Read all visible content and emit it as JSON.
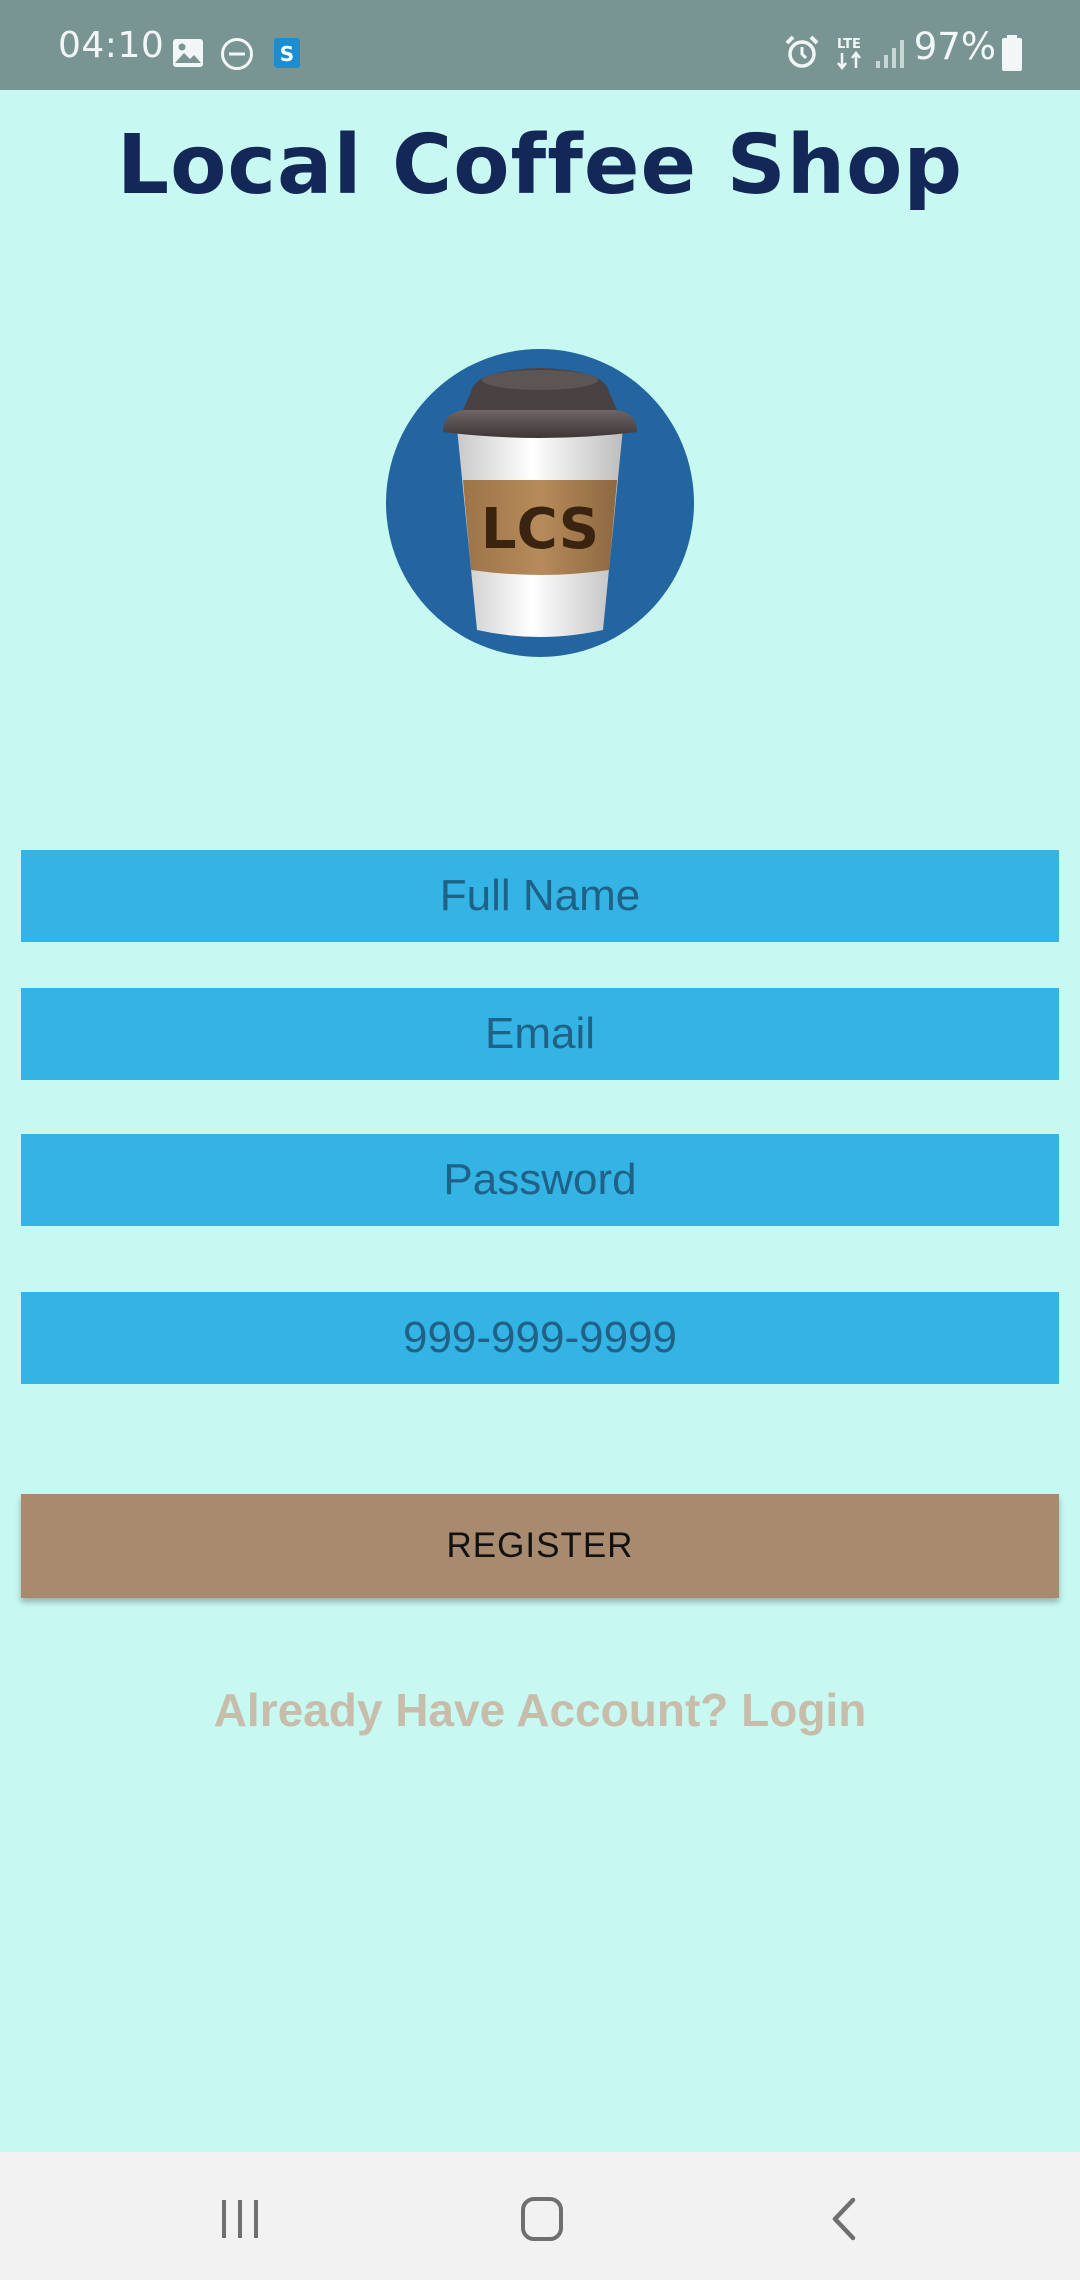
{
  "status_bar": {
    "time": "04:10",
    "battery": "97%",
    "network": "LTE",
    "icons": [
      "image-icon",
      "do-not-disturb-icon",
      "s-app-icon",
      "alarm-icon",
      "lte-icon",
      "signal-icon",
      "battery-icon"
    ]
  },
  "app": {
    "title": "Local Coffee Shop",
    "logo_text": "LCS"
  },
  "form": {
    "full_name_placeholder": "Full Name",
    "email_placeholder": "Email",
    "password_placeholder": "Password",
    "phone_placeholder": "999-999-9999",
    "register_label": "REGISTER",
    "login_link": "Already Have Account? Login"
  },
  "nav_bar": {
    "icons": [
      "recent-apps-icon",
      "home-icon",
      "back-icon"
    ]
  },
  "colors": {
    "background": "#c8f8f2",
    "status_bar": "#799593",
    "title": "#142858",
    "field": "#33b4e5",
    "field_text": "#1f6286",
    "register_button": "#a88a6e",
    "login_link": "#c7bdaa",
    "logo_circle": "#2265a0"
  }
}
